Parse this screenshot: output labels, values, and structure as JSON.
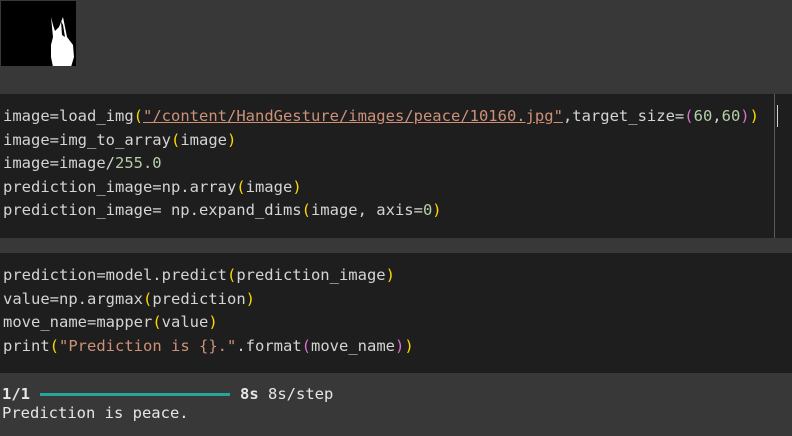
{
  "output_image": {
    "icon": "hand-gesture-thumbnail",
    "alt_text": ""
  },
  "cell1": {
    "lines": [
      [
        {
          "t": "image=load_img"
        },
        {
          "t": "(",
          "c": "p1"
        },
        {
          "t": "\"/content/HandGesture/images/peace/10160.jpg\"",
          "c": "str"
        },
        {
          "t": ",target_size="
        },
        {
          "t": "(",
          "c": "p2"
        },
        {
          "t": "60",
          "c": "num"
        },
        {
          "t": ","
        },
        {
          "t": "60",
          "c": "num"
        },
        {
          "t": ")",
          "c": "p2"
        },
        {
          "t": ")",
          "c": "p1"
        }
      ],
      [
        {
          "t": "image=img_to_array"
        },
        {
          "t": "(",
          "c": "p1"
        },
        {
          "t": "image"
        },
        {
          "t": ")",
          "c": "p1"
        }
      ],
      [
        {
          "t": "image=image/"
        },
        {
          "t": "255.0",
          "c": "num"
        }
      ],
      [
        {
          "t": "prediction_image=np.array"
        },
        {
          "t": "(",
          "c": "p1"
        },
        {
          "t": "image"
        },
        {
          "t": ")",
          "c": "p1"
        }
      ],
      [
        {
          "t": "prediction_image= np.expand_dims"
        },
        {
          "t": "(",
          "c": "p1"
        },
        {
          "t": "image, axis="
        },
        {
          "t": "0",
          "c": "num"
        },
        {
          "t": ")",
          "c": "p1"
        }
      ]
    ]
  },
  "cell2": {
    "lines": [
      [
        {
          "t": "prediction=model.predict"
        },
        {
          "t": "(",
          "c": "p1"
        },
        {
          "t": "prediction_image"
        },
        {
          "t": ")",
          "c": "p1"
        }
      ],
      [
        {
          "t": "value=np.argmax"
        },
        {
          "t": "(",
          "c": "p1"
        },
        {
          "t": "prediction"
        },
        {
          "t": ")",
          "c": "p1"
        }
      ],
      [
        {
          "t": "move_name=mapper"
        },
        {
          "t": "(",
          "c": "p1"
        },
        {
          "t": "value"
        },
        {
          "t": ")",
          "c": "p1"
        }
      ],
      [
        {
          "t": "print"
        },
        {
          "t": "(",
          "c": "p1"
        },
        {
          "t": "\"Prediction is {}.\"",
          "c": "str-plain"
        },
        {
          "t": ".format"
        },
        {
          "t": "(",
          "c": "p2"
        },
        {
          "t": "move_name"
        },
        {
          "t": ")",
          "c": "p2"
        },
        {
          "t": ")",
          "c": "p1"
        }
      ]
    ]
  },
  "output": {
    "step_count": "1/1",
    "progress": 1.0,
    "elapsed": "8s",
    "per_step": "8s/step",
    "result_text": "Prediction is peace."
  },
  "colors": {
    "editor_bg": "#1e1e1e",
    "output_bg": "#383838",
    "progress_bar": "#26a69a"
  }
}
